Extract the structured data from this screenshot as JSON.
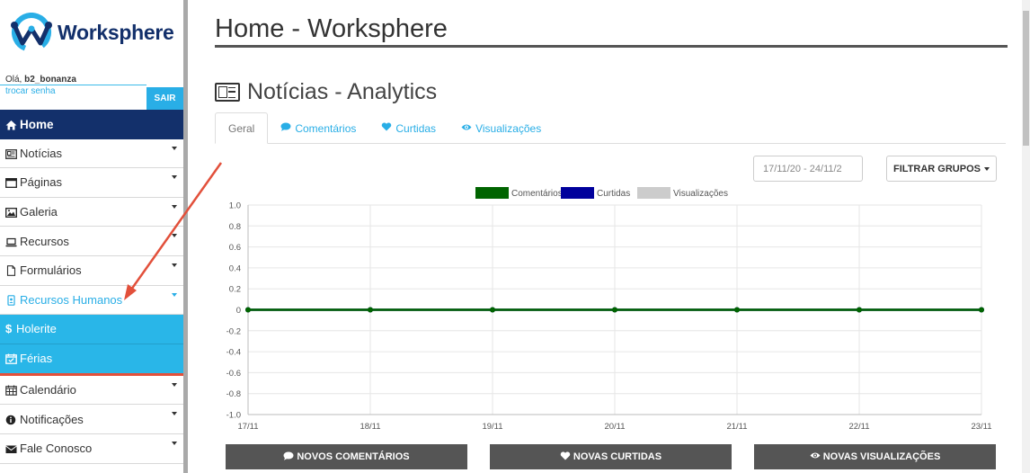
{
  "app": {
    "brand": "Worksphere",
    "colors": {
      "navy": "#13306b",
      "accent": "#29aee6",
      "arrow": "#e2503b"
    }
  },
  "user": {
    "greeting": "Olá, ",
    "username": "b2_bonanza",
    "change_password": "trocar senha",
    "logout": "SAIR"
  },
  "sidebar": {
    "items": [
      {
        "label": "Home",
        "icon": "home-icon"
      },
      {
        "label": "Notícias",
        "icon": "newspaper-icon"
      },
      {
        "label": "Páginas",
        "icon": "window-icon"
      },
      {
        "label": "Galeria",
        "icon": "image-icon"
      },
      {
        "label": "Recursos",
        "icon": "laptop-icon"
      },
      {
        "label": "Formulários",
        "icon": "file-icon"
      },
      {
        "label": "Recursos Humanos",
        "icon": "badge-icon"
      },
      {
        "label": "Holerite",
        "icon": "dollar-icon"
      },
      {
        "label": "Férias",
        "icon": "calendar-check-icon"
      },
      {
        "label": "Calendário",
        "icon": "calendar-icon"
      },
      {
        "label": "Notificações",
        "icon": "info-icon"
      },
      {
        "label": "Fale Conosco",
        "icon": "envelope-icon"
      }
    ]
  },
  "main": {
    "page_title": "Home - Worksphere",
    "section_title": "Notícias - Analytics",
    "tabs": [
      {
        "label": "Geral",
        "icon": ""
      },
      {
        "label": "Comentários",
        "icon": "comment-icon"
      },
      {
        "label": "Curtidas",
        "icon": "heart-icon"
      },
      {
        "label": "Visualizações",
        "icon": "eye-icon"
      }
    ],
    "date_range": "17/11/20 - 24/11/2",
    "filter_button": "FILTRAR GRUPOS",
    "footer_buttons": [
      {
        "label": "NOVOS COMENTÁRIOS",
        "icon": "comment-icon"
      },
      {
        "label": "NOVAS CURTIDAS",
        "icon": "heart-icon"
      },
      {
        "label": "NOVAS VISUALIZAÇÕES",
        "icon": "eye-icon"
      }
    ]
  },
  "chart_data": {
    "type": "line",
    "categories": [
      "17/11",
      "18/11",
      "19/11",
      "20/11",
      "21/11",
      "22/11",
      "23/11"
    ],
    "series": [
      {
        "name": "Comentários",
        "color": "#006400",
        "values": [
          0,
          0,
          0,
          0,
          0,
          0,
          0
        ]
      },
      {
        "name": "Curtidas",
        "color": "#00009c",
        "values": [
          0,
          0,
          0,
          0,
          0,
          0,
          0
        ]
      },
      {
        "name": "Visualizações",
        "color": "#cccccc",
        "values": [
          0,
          0,
          0,
          0,
          0,
          0,
          0
        ]
      }
    ],
    "yticks": [
      "1.0",
      "0.8",
      "0.6",
      "0.4",
      "0.2",
      "0",
      "-0.2",
      "-0.4",
      "-0.6",
      "-0.8",
      "-1.0"
    ],
    "ylim": [
      -1,
      1
    ],
    "grid": true,
    "legend": "top-center",
    "title": "",
    "xlabel": "",
    "ylabel": ""
  }
}
